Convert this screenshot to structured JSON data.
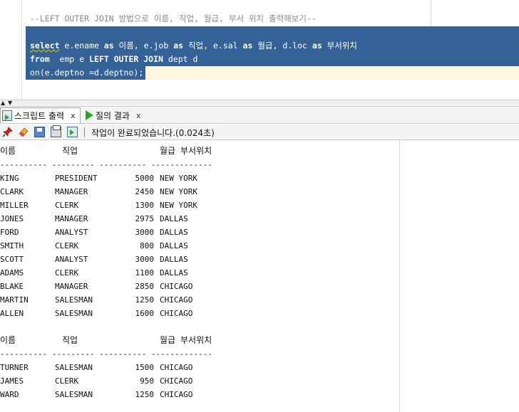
{
  "editor": {
    "comment": "--LEFT OUTER JOIN 방법으로 이름, 직업, 월급, 부서 위치 출력해보기--",
    "sql": {
      "line1_kw_select": "select",
      "line1_rest_a": " e.ename ",
      "line1_kw_as1": "as",
      "line1_rest_b": " 이름, e.job ",
      "line1_kw_as2": "as",
      "line1_rest_c": " 직업, e.sal ",
      "line1_kw_as3": "as",
      "line1_rest_d": " 월급, d.loc ",
      "line1_kw_as4": "as",
      "line1_rest_e": " 부서위치",
      "line2_kw_from": "from",
      "line2_rest_a": "  emp e ",
      "line2_kw_join": "LEFT OUTER JOIN",
      "line2_rest_b": " dept d",
      "line3": "on(e.deptno =d.deptno);"
    }
  },
  "tabs": {
    "script_output": "스크립트 출력",
    "query_result": "질의 결과",
    "close": "x"
  },
  "toolbar": {
    "status": "작업이 완료되었습니다.(0.024초)"
  },
  "output": {
    "headers": {
      "name": "이름",
      "job": "직업",
      "sal": "월급",
      "loc": "부서위치"
    },
    "separator": "---------- --------- ---------- -------------",
    "block1": [
      {
        "name": "KING",
        "job": "PRESIDENT",
        "sal": "5000",
        "loc": "NEW YORK"
      },
      {
        "name": "CLARK",
        "job": "MANAGER",
        "sal": "2450",
        "loc": "NEW YORK"
      },
      {
        "name": "MILLER",
        "job": "CLERK",
        "sal": "1300",
        "loc": "NEW YORK"
      },
      {
        "name": "JONES",
        "job": "MANAGER",
        "sal": "2975",
        "loc": "DALLAS"
      },
      {
        "name": "FORD",
        "job": "ANALYST",
        "sal": "3000",
        "loc": "DALLAS"
      },
      {
        "name": "SMITH",
        "job": "CLERK",
        "sal": "800",
        "loc": "DALLAS"
      },
      {
        "name": "SCOTT",
        "job": "ANALYST",
        "sal": "3000",
        "loc": "DALLAS"
      },
      {
        "name": "ADAMS",
        "job": "CLERK",
        "sal": "1100",
        "loc": "DALLAS"
      },
      {
        "name": "BLAKE",
        "job": "MANAGER",
        "sal": "2850",
        "loc": "CHICAGO"
      },
      {
        "name": "MARTIN",
        "job": "SALESMAN",
        "sal": "1250",
        "loc": "CHICAGO"
      },
      {
        "name": "ALLEN",
        "job": "SALESMAN",
        "sal": "1600",
        "loc": "CHICAGO"
      }
    ],
    "block2": [
      {
        "name": "TURNER",
        "job": "SALESMAN",
        "sal": "1500",
        "loc": "CHICAGO"
      },
      {
        "name": "JAMES",
        "job": "CLERK",
        "sal": "950",
        "loc": "CHICAGO"
      },
      {
        "name": "WARD",
        "job": "SALESMAN",
        "sal": "1250",
        "loc": "CHICAGO"
      }
    ]
  },
  "colors": {
    "selection": "#356296",
    "current_line": "#fdf6dc",
    "run_green": "#2fa12f"
  }
}
